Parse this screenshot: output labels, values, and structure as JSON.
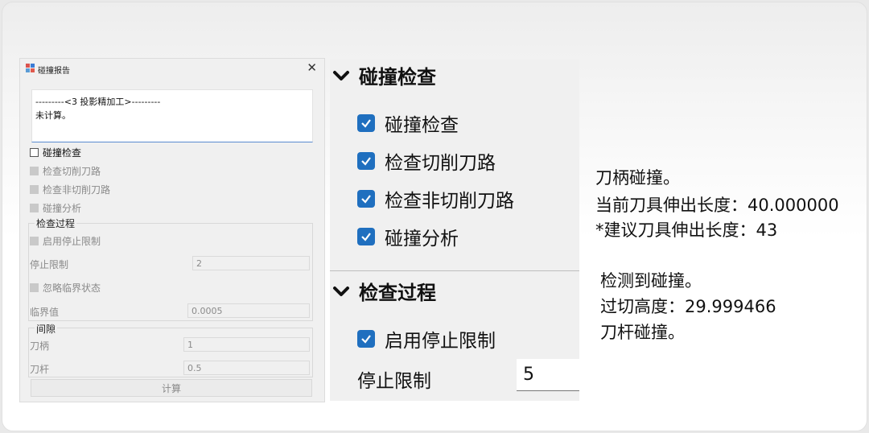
{
  "dialog": {
    "title": "碰撞报告",
    "close": "✕",
    "output_line1": "---------<3 投影精加工>---------",
    "output_line2": "未计算。",
    "collision_check": "碰撞检查",
    "check_cutting": "检查切削刀路",
    "check_noncutting": "检查非切削刀路",
    "collision_analysis": "碰撞分析",
    "process_group": "检查过程",
    "enable_stop_limit": "启用停止限制",
    "stop_limit_label": "停止限制",
    "stop_limit_value": "2",
    "ignore_critical": "忽略临界状态",
    "critical_label": "临界值",
    "critical_value": "0.0005",
    "clearance_group": "间隙",
    "holder_label": "刀柄",
    "holder_value": "1",
    "shank_label": "刀杆",
    "shank_value": "0.5",
    "compute_button": "计算"
  },
  "zoom": {
    "section1": "碰撞检查",
    "items": [
      "碰撞检查",
      "检查切削刀路",
      "检查非切削刀路",
      "碰撞分析"
    ],
    "section2": "检查过程",
    "enable_stop_limit": "启用停止限制",
    "stop_limit_label": "停止限制",
    "stop_limit_value": "5"
  },
  "result": {
    "lines1": [
      "刀柄碰撞。",
      "当前刀具伸出长度：40.000000",
      "*建议刀具伸出长度：43"
    ],
    "lines2": [
      "检测到碰撞。",
      "过切高度：29.999466",
      "刀杆碰撞。"
    ]
  },
  "colors": {
    "checkbox_blue": "#1f6fbf"
  }
}
